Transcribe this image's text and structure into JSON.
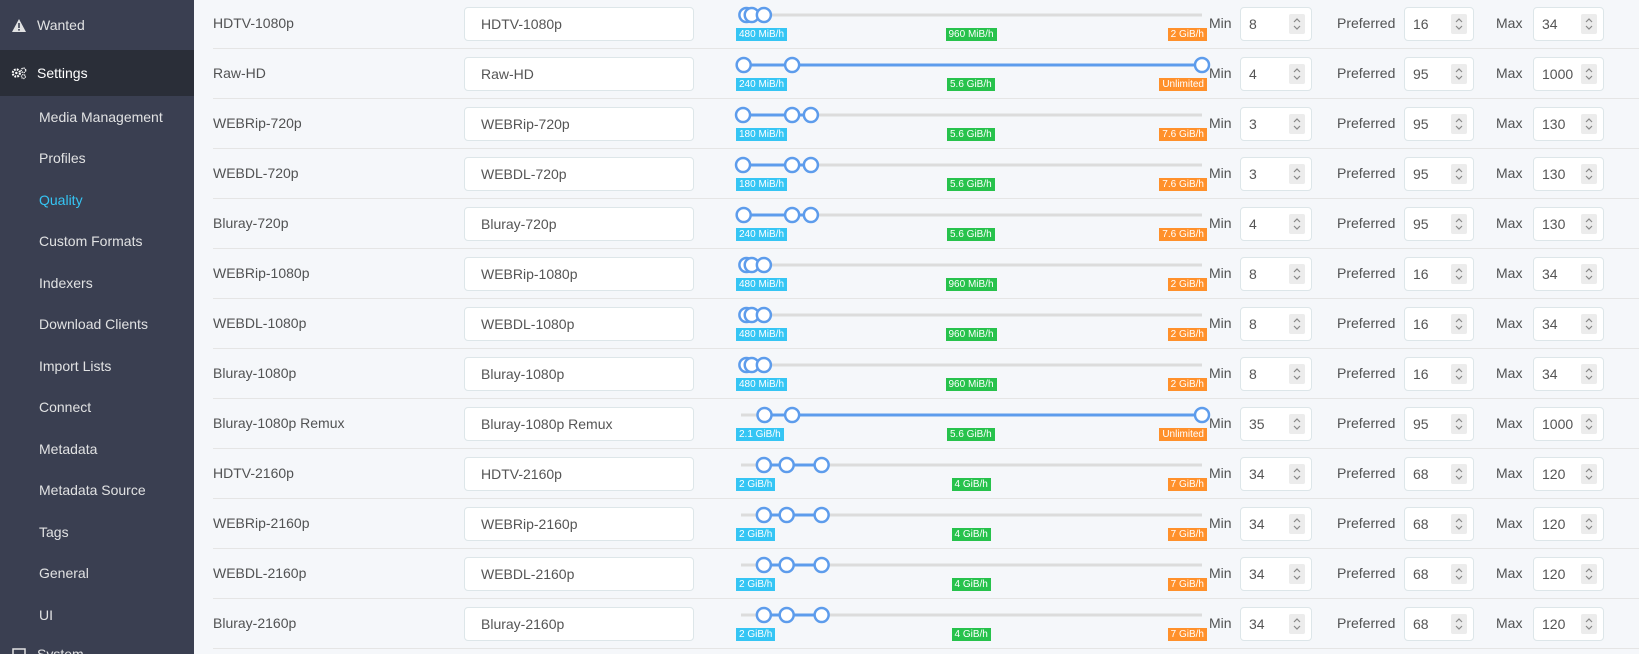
{
  "sidebar": {
    "wanted": {
      "label": "Wanted",
      "icon": "warning-icon"
    },
    "settings": {
      "label": "Settings",
      "icon": "cogs-icon"
    },
    "items": [
      {
        "id": "media-management",
        "label": "Media Management"
      },
      {
        "id": "profiles",
        "label": "Profiles"
      },
      {
        "id": "quality",
        "label": "Quality",
        "current": true
      },
      {
        "id": "custom-formats",
        "label": "Custom Formats"
      },
      {
        "id": "indexers",
        "label": "Indexers"
      },
      {
        "id": "download-clients",
        "label": "Download Clients"
      },
      {
        "id": "import-lists",
        "label": "Import Lists"
      },
      {
        "id": "connect",
        "label": "Connect"
      },
      {
        "id": "metadata",
        "label": "Metadata"
      },
      {
        "id": "metadata-source",
        "label": "Metadata Source"
      },
      {
        "id": "tags",
        "label": "Tags"
      },
      {
        "id": "general",
        "label": "General"
      },
      {
        "id": "ui",
        "label": "UI"
      }
    ],
    "system": {
      "label": "System",
      "icon": "computer-icon"
    }
  },
  "field_labels": {
    "min": "Min",
    "preferred": "Preferred",
    "max": "Max"
  },
  "colors": {
    "accent": "#35c5f4",
    "slider": "#5d9cec",
    "preferred_badge": "#27c24c",
    "max_badge": "#ff902b"
  },
  "rows": [
    {
      "name": "HDTV-1080p",
      "title": "HDTV-1080p",
      "min": "8",
      "preferred": "16",
      "max": "34",
      "min_label": "480 MiB/h",
      "pref_label": "960 MiB/h",
      "max_label": "2 GiB/h",
      "slider": [
        0.0117,
        0.0233,
        0.0496
      ]
    },
    {
      "name": "Raw-HD",
      "title": "Raw-HD",
      "min": "4",
      "preferred": "95",
      "max": "1000",
      "min_label": "240 MiB/h",
      "pref_label": "5.6 GiB/h",
      "max_label": "Unlimited",
      "slider": [
        0.0058,
        0.1109,
        1.0
      ]
    },
    {
      "name": "WEBRip-720p",
      "title": "WEBRip-720p",
      "min": "3",
      "preferred": "95",
      "max": "130",
      "min_label": "180 MiB/h",
      "pref_label": "5.6 GiB/h",
      "max_label": "7.6 GiB/h",
      "slider": [
        0.0044,
        0.1109,
        0.1516
      ]
    },
    {
      "name": "WEBDL-720p",
      "title": "WEBDL-720p",
      "min": "3",
      "preferred": "95",
      "max": "130",
      "min_label": "180 MiB/h",
      "pref_label": "5.6 GiB/h",
      "max_label": "7.6 GiB/h",
      "slider": [
        0.0044,
        0.1109,
        0.1516
      ]
    },
    {
      "name": "Bluray-720p",
      "title": "Bluray-720p",
      "min": "4",
      "preferred": "95",
      "max": "130",
      "min_label": "240 MiB/h",
      "pref_label": "5.6 GiB/h",
      "max_label": "7.6 GiB/h",
      "slider": [
        0.0058,
        0.1109,
        0.1516
      ]
    },
    {
      "name": "WEBRip-1080p",
      "title": "WEBRip-1080p",
      "min": "8",
      "preferred": "16",
      "max": "34",
      "min_label": "480 MiB/h",
      "pref_label": "960 MiB/h",
      "max_label": "2 GiB/h",
      "slider": [
        0.0117,
        0.0233,
        0.0496
      ]
    },
    {
      "name": "WEBDL-1080p",
      "title": "WEBDL-1080p",
      "min": "8",
      "preferred": "16",
      "max": "34",
      "min_label": "480 MiB/h",
      "pref_label": "960 MiB/h",
      "max_label": "2 GiB/h",
      "slider": [
        0.0117,
        0.0233,
        0.0496
      ]
    },
    {
      "name": "Bluray-1080p",
      "title": "Bluray-1080p",
      "min": "8",
      "preferred": "16",
      "max": "34",
      "min_label": "480 MiB/h",
      "pref_label": "960 MiB/h",
      "max_label": "2 GiB/h",
      "slider": [
        0.0117,
        0.0233,
        0.0496
      ]
    },
    {
      "name": "Bluray-1080p Remux",
      "title": "Bluray-1080p Remux",
      "min": "35",
      "preferred": "95",
      "max": "1000",
      "min_label": "2.1 GiB/h",
      "pref_label": "5.6 GiB/h",
      "max_label": "Unlimited",
      "slider": [
        0.051,
        0.1109,
        1.0
      ]
    },
    {
      "name": "HDTV-2160p",
      "title": "HDTV-2160p",
      "min": "34",
      "preferred": "68",
      "max": "120",
      "min_label": "2 GiB/h",
      "pref_label": "4 GiB/h",
      "max_label": "7 GiB/h",
      "slider": [
        0.0496,
        0.0991,
        0.1749
      ]
    },
    {
      "name": "WEBRip-2160p",
      "title": "WEBRip-2160p",
      "min": "34",
      "preferred": "68",
      "max": "120",
      "min_label": "2 GiB/h",
      "pref_label": "4 GiB/h",
      "max_label": "7 GiB/h",
      "slider": [
        0.0496,
        0.0991,
        0.1749
      ]
    },
    {
      "name": "WEBDL-2160p",
      "title": "WEBDL-2160p",
      "min": "34",
      "preferred": "68",
      "max": "120",
      "min_label": "2 GiB/h",
      "pref_label": "4 GiB/h",
      "max_label": "7 GiB/h",
      "slider": [
        0.0496,
        0.0991,
        0.1749
      ]
    },
    {
      "name": "Bluray-2160p",
      "title": "Bluray-2160p",
      "min": "34",
      "preferred": "68",
      "max": "120",
      "min_label": "2 GiB/h",
      "pref_label": "4 GiB/h",
      "max_label": "7 GiB/h",
      "slider": [
        0.0496,
        0.0991,
        0.1749
      ]
    }
  ]
}
